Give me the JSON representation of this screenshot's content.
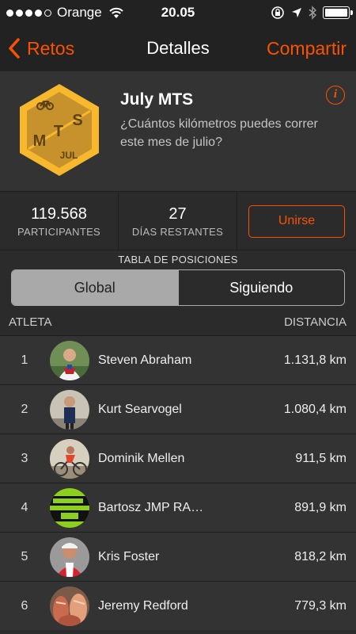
{
  "status_bar": {
    "carrier": "Orange",
    "time": "20.05",
    "signal_bars_filled": 4,
    "signal_bars_total": 5
  },
  "nav": {
    "back_label": "Retos",
    "title": "Detalles",
    "share_label": "Compartir"
  },
  "challenge": {
    "badge": {
      "letters": [
        "M",
        "T",
        "S"
      ],
      "month": "JUL",
      "colors": {
        "outer": "#f7b82d",
        "inner": "#c7922b",
        "text": "#5e4216"
      }
    },
    "title": "July MTS",
    "description": "¿Cuántos kilómetros puedes correr este mes de julio?"
  },
  "stats": {
    "participants_value": "119.568",
    "participants_label": "PARTICIPANTES",
    "days_value": "27",
    "days_label": "DÍAS RESTANTES",
    "join_label": "Unirse"
  },
  "leaderboard": {
    "title": "TABLA DE POSICIONES",
    "tabs": {
      "global": "Global",
      "following": "Siguiendo",
      "selected": "Global"
    },
    "header": {
      "athlete": "ATLETA",
      "distance": "DISTANCIA"
    },
    "rows": [
      {
        "rank": "1",
        "name": "Steven Abraham",
        "distance": "1.131,8 km",
        "avatar": "avatar-steven"
      },
      {
        "rank": "2",
        "name": "Kurt Searvogel",
        "distance": "1.080,4 km",
        "avatar": "avatar-kurt"
      },
      {
        "rank": "3",
        "name": "Dominik Mellen",
        "distance": "911,5 km",
        "avatar": "avatar-dominik"
      },
      {
        "rank": "4",
        "name": "Bartosz JMP RA…",
        "distance": "891,9 km",
        "avatar": "avatar-bartosz"
      },
      {
        "rank": "5",
        "name": "Kris Foster",
        "distance": "818,2 km",
        "avatar": "avatar-kris"
      },
      {
        "rank": "6",
        "name": "Jeremy Redford",
        "distance": "779,3 km",
        "avatar": "avatar-jeremy"
      }
    ]
  },
  "colors": {
    "accent": "#fc5200",
    "background": "#2b2b2b",
    "bar": "#222222"
  }
}
